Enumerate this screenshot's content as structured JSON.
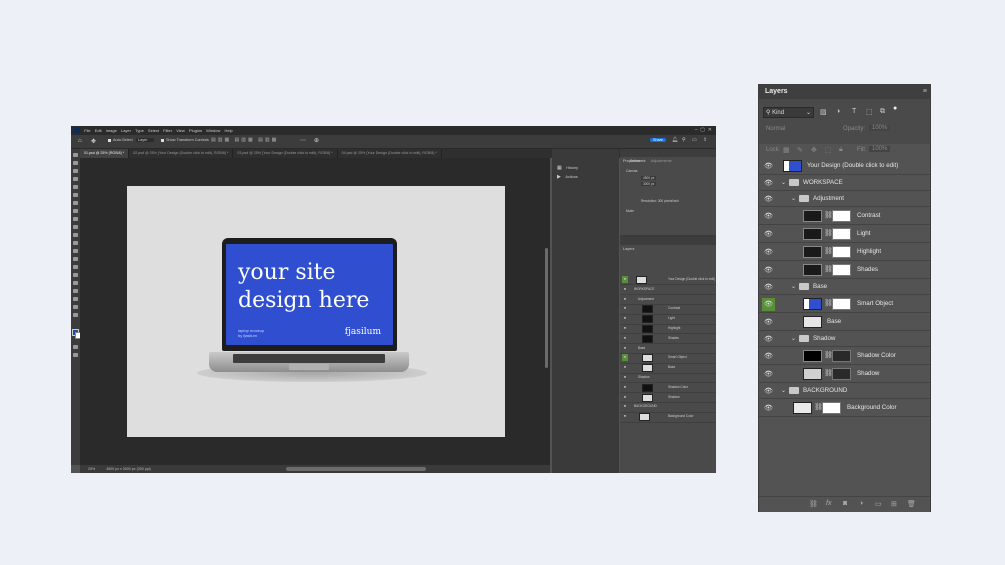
{
  "photoshop": {
    "menu": [
      "File",
      "Edit",
      "Image",
      "Layer",
      "Type",
      "Select",
      "Filter",
      "View",
      "Plugins",
      "Window",
      "Help"
    ],
    "options": {
      "auto_select": "Auto-Select",
      "layer_dropdown": "Layer",
      "show_transform": "Show Transform Controls",
      "share": "Share"
    },
    "tabs": [
      {
        "label": "01.psd @ 25% (RGB/8) *",
        "active": true
      },
      {
        "label": "02.psd @ 25% (Your Design (Double click to edit), RGB/8) *",
        "active": false
      },
      {
        "label": "03.psd @ 25% (Your Design (Double click to edit), RGB/8) *",
        "active": false
      },
      {
        "label": "04.psd @ 25% (Your Design (Double click to edit), RGB/8) *",
        "active": false
      }
    ],
    "status": {
      "zoom": "25%",
      "doc_size": "4500 px x 3000 px (300 ppi)"
    },
    "mid_panel": {
      "history": "History",
      "actions": "Actions"
    },
    "properties": {
      "tab1": "Properties",
      "tab2": "Adjustments",
      "doc_label": "Document",
      "canvas": "Canvas",
      "w": "4500 px",
      "h": "3000 px",
      "resolution": "Resolution: 300 pixels/inch",
      "mode": "Mode"
    },
    "mini_layers_title": "Layers",
    "screen": {
      "headline_line1": "your site",
      "headline_line2": "design here",
      "sub1": "laptop mockup",
      "sub2": "by fjasilum",
      "brand": "fjasilum"
    }
  },
  "layers_panel": {
    "title": "Layers",
    "kind": "Kind",
    "blend_mode": "Normal",
    "opacity_label": "Opacity:",
    "opacity_value": "100%",
    "lock_label": "Lock:",
    "fill_label": "Fill:",
    "fill_value": "100%",
    "rows": [
      {
        "name": "Your Design  (Double click to edit)",
        "type": "smart",
        "indent": 0,
        "hl": false
      },
      {
        "name": "WORKSPACE",
        "type": "folder",
        "indent": 0,
        "hl": false
      },
      {
        "name": "Adjustment",
        "type": "folder",
        "indent": 1,
        "hl": false
      },
      {
        "name": "Contrast",
        "type": "adj",
        "indent": 2,
        "hl": false
      },
      {
        "name": "Light",
        "type": "adj",
        "indent": 2,
        "hl": false
      },
      {
        "name": "Highlight",
        "type": "adj",
        "indent": 2,
        "hl": false
      },
      {
        "name": "Shades",
        "type": "adj",
        "indent": 2,
        "hl": false
      },
      {
        "name": "Base",
        "type": "folder",
        "indent": 1,
        "hl": false
      },
      {
        "name": "Smart Object",
        "type": "smart2",
        "indent": 2,
        "hl": true
      },
      {
        "name": "Base",
        "type": "layer",
        "indent": 2,
        "hl": false
      },
      {
        "name": "Shadow",
        "type": "folder",
        "indent": 1,
        "hl": false
      },
      {
        "name": "Shadow Color",
        "type": "shadowcolor",
        "indent": 2,
        "hl": false
      },
      {
        "name": "Shadow",
        "type": "shadow",
        "indent": 2,
        "hl": false
      },
      {
        "name": "BACKGROUND",
        "type": "folder",
        "indent": 0,
        "hl": false
      },
      {
        "name": "Background Color",
        "type": "bg",
        "indent": 1,
        "hl": false
      }
    ]
  }
}
